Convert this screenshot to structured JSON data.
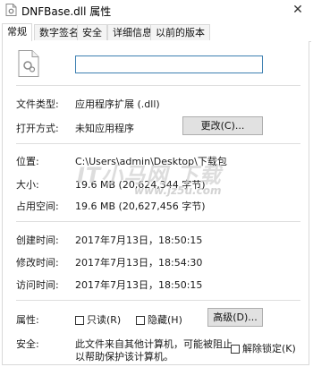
{
  "window": {
    "title": "DNFBase.dll 属性",
    "close_glyph": "✕"
  },
  "tabs": [
    {
      "label": "常规",
      "active": true
    },
    {
      "label": "数字签名",
      "active": false
    },
    {
      "label": "安全",
      "active": false
    },
    {
      "label": "详细信息",
      "active": false
    },
    {
      "label": "以前的版本",
      "active": false
    }
  ],
  "general": {
    "file_name_value": "",
    "file_type_label": "文件类型:",
    "file_type_value": "应用程序扩展 (.dll)",
    "opens_with_label": "打开方式:",
    "opens_with_value": "未知应用程序",
    "change_button": "更改(C)...",
    "location_label": "位置:",
    "location_value": "C:\\Users\\admin\\Desktop\\下载包",
    "size_label": "大小:",
    "size_value": "19.6 MB (20,624,344 字节)",
    "size_on_disk_label": "占用空间:",
    "size_on_disk_value": "19.6 MB (20,627,456 字节)",
    "created_label": "创建时间:",
    "created_value": "2017年7月13日，18:50:15",
    "modified_label": "修改时间:",
    "modified_value": "2017年7月13日，18:54:30",
    "accessed_label": "访问时间:",
    "accessed_value": "2017年7月13日，18:50:15",
    "attributes_label": "属性:",
    "readonly_label": "只读(R)",
    "readonly_checked": false,
    "hidden_label": "隐藏(H)",
    "hidden_checked": false,
    "advanced_button": "高级(D)...",
    "security_label": "安全:",
    "security_text_line1": "此文件来自其他计算机，可能被阻止",
    "security_text_line2": "以帮助保护该计算机。",
    "unblock_label": "解除锁定(K)",
    "unblock_checked": false
  },
  "watermark": {
    "text": "IT小马网 下载",
    "url": "www.jz5u.com"
  },
  "icons": {
    "app": "dll-file-icon",
    "file": "dll-file-icon",
    "close": "close-icon"
  }
}
